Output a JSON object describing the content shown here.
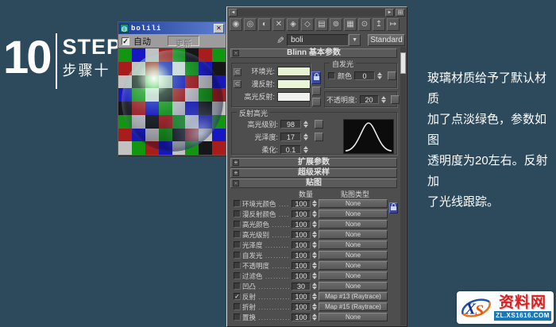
{
  "page": {
    "bg": "#2d4a5c"
  },
  "banner": {
    "number": "10",
    "word": "STEP",
    "subtitle": "步骤十"
  },
  "preview_window": {
    "title": "bolili",
    "close_glyph": "✕",
    "window_icon_glyph": "◍",
    "auto_checkbox": {
      "label": "自动",
      "checked": true,
      "check_glyph": "✓"
    },
    "update_label": "更新",
    "checker": [
      [
        "#129612",
        "#1616c2",
        "#c2c2c2",
        "#a81c1c",
        "#129612",
        "#161616",
        "#a81c1c",
        "#129612"
      ],
      [
        "#a81c1c",
        "#c2c2c2",
        "#a81c1c",
        "#1616c2",
        "#e2e2e2",
        "#129612",
        "#1616c2",
        "#161616"
      ],
      [
        "#c2c2c2",
        "#161616",
        "#129612",
        "#c2c2c2",
        "#1616c2",
        "#a81c1c",
        "#c2c2c2",
        "#1616c2"
      ],
      [
        "#1616c2",
        "#129612",
        "#e2e2e2",
        "#161616",
        "#a81c1c",
        "#c2c2c2",
        "#129612",
        "#a81c1c"
      ],
      [
        "#161616",
        "#a81c1c",
        "#1616c2",
        "#129612",
        "#c2c2c2",
        "#1616c2",
        "#161616",
        "#c2c2c2"
      ],
      [
        "#129612",
        "#c2c2c2",
        "#161616",
        "#a81c1c",
        "#129612",
        "#e2e2e2",
        "#1616c2",
        "#129612"
      ],
      [
        "#a81c1c",
        "#1616c2",
        "#c2c2c2",
        "#129612",
        "#161616",
        "#a81c1c",
        "#c2c2c2",
        "#1616c2"
      ],
      [
        "#c2c2c2",
        "#129612",
        "#a81c1c",
        "#1616c2",
        "#c2c2c2",
        "#129612",
        "#161616",
        "#a81c1c"
      ]
    ]
  },
  "editor": {
    "scroll": {
      "left_glyph": "◄",
      "right_glyph": "►",
      "corner_glyph": "⊞"
    },
    "toolbar_icons": [
      {
        "name": "get-material-icon",
        "glyph": "◉"
      },
      {
        "name": "put-material-to-scene-icon",
        "glyph": "◎"
      },
      {
        "name": "assign-material-to-selection-icon",
        "glyph": "◐"
      },
      {
        "name": "reset-map-icon",
        "glyph": "✕"
      },
      {
        "name": "make-material-copy-icon",
        "glyph": "◈"
      },
      {
        "name": "make-unique-icon",
        "glyph": "◇"
      },
      {
        "name": "put-to-library-icon",
        "glyph": "▤"
      },
      {
        "name": "material-id-channel-icon",
        "glyph": "⊚"
      },
      {
        "name": "show-map-in-viewport-icon",
        "glyph": "▦"
      },
      {
        "name": "show-end-result-icon",
        "glyph": "⊙"
      },
      {
        "name": "go-to-parent-icon",
        "glyph": "↥"
      },
      {
        "name": "go-forward-to-sibling-icon",
        "glyph": "↦"
      }
    ],
    "eyedropper_glyph": "✎",
    "material_name": "boli",
    "combo_arrow_glyph": "▼",
    "type_button": "Standard",
    "blinn": {
      "state": "-",
      "title": "Blinn 基本参数",
      "lock_toggle_glyph": "⊂",
      "ambient_label": "环境光:",
      "diffuse_label": "漫反射:",
      "specular_label": "高光反射:",
      "ambient_color": "#e6f3d0",
      "diffuse_color": "#eaf6da",
      "specular_color": "#eff1ec",
      "selfillum_title": "自发光",
      "selfillum_color_label": "颜色",
      "selfillum_value": "0",
      "opacity_label": "不透明度:",
      "opacity_value": "20",
      "highlight_title": "反射高光",
      "specular_level_label": "高光级别:",
      "specular_level_value": "98",
      "glossiness_label": "光泽度:",
      "glossiness_value": "17",
      "soften_label": "柔化:",
      "soften_value": "0.1"
    },
    "rollouts": [
      {
        "label": "扩展参数",
        "state": "+"
      },
      {
        "label": "超级采样",
        "state": "+"
      },
      {
        "label": "贴图",
        "state": "-"
      }
    ],
    "maps": {
      "amount_header": "数量",
      "type_header": "贴图类型",
      "check_glyph": "✓",
      "rows": [
        {
          "label": "环境光颜色",
          "checked": false,
          "amount": "100",
          "map": "None"
        },
        {
          "label": "漫反射颜色",
          "checked": false,
          "amount": "100",
          "map": "None",
          "locked": true
        },
        {
          "label": "高光颜色",
          "checked": false,
          "amount": "100",
          "map": "None"
        },
        {
          "label": "高光级别",
          "checked": false,
          "amount": "100",
          "map": "None"
        },
        {
          "label": "光泽度",
          "checked": false,
          "amount": "100",
          "map": "None"
        },
        {
          "label": "自发光",
          "checked": false,
          "amount": "100",
          "map": "None"
        },
        {
          "label": "不透明度",
          "checked": false,
          "amount": "100",
          "map": "None"
        },
        {
          "label": "过滤色",
          "checked": false,
          "amount": "100",
          "map": "None"
        },
        {
          "label": "凹凸",
          "checked": false,
          "amount": "30",
          "map": "None"
        },
        {
          "label": "反射",
          "checked": true,
          "amount": "100",
          "map": "Map #13 (Raytrace)"
        },
        {
          "label": "折射",
          "checked": false,
          "amount": "100",
          "map": "Map #15 (Raytrace)"
        },
        {
          "label": "置换",
          "checked": false,
          "amount": "100",
          "map": "None"
        }
      ]
    }
  },
  "description": {
    "lines": [
      "玻璃材质给予了默认材质",
      "加了点淡绿色，参数如图",
      "透明度为20左右。反射加",
      "了光线跟踪。"
    ]
  },
  "watermark": {
    "logo_x": "X",
    "logo_s": "S",
    "site": "资料网",
    "url": "ZL.XS1616.COM"
  }
}
